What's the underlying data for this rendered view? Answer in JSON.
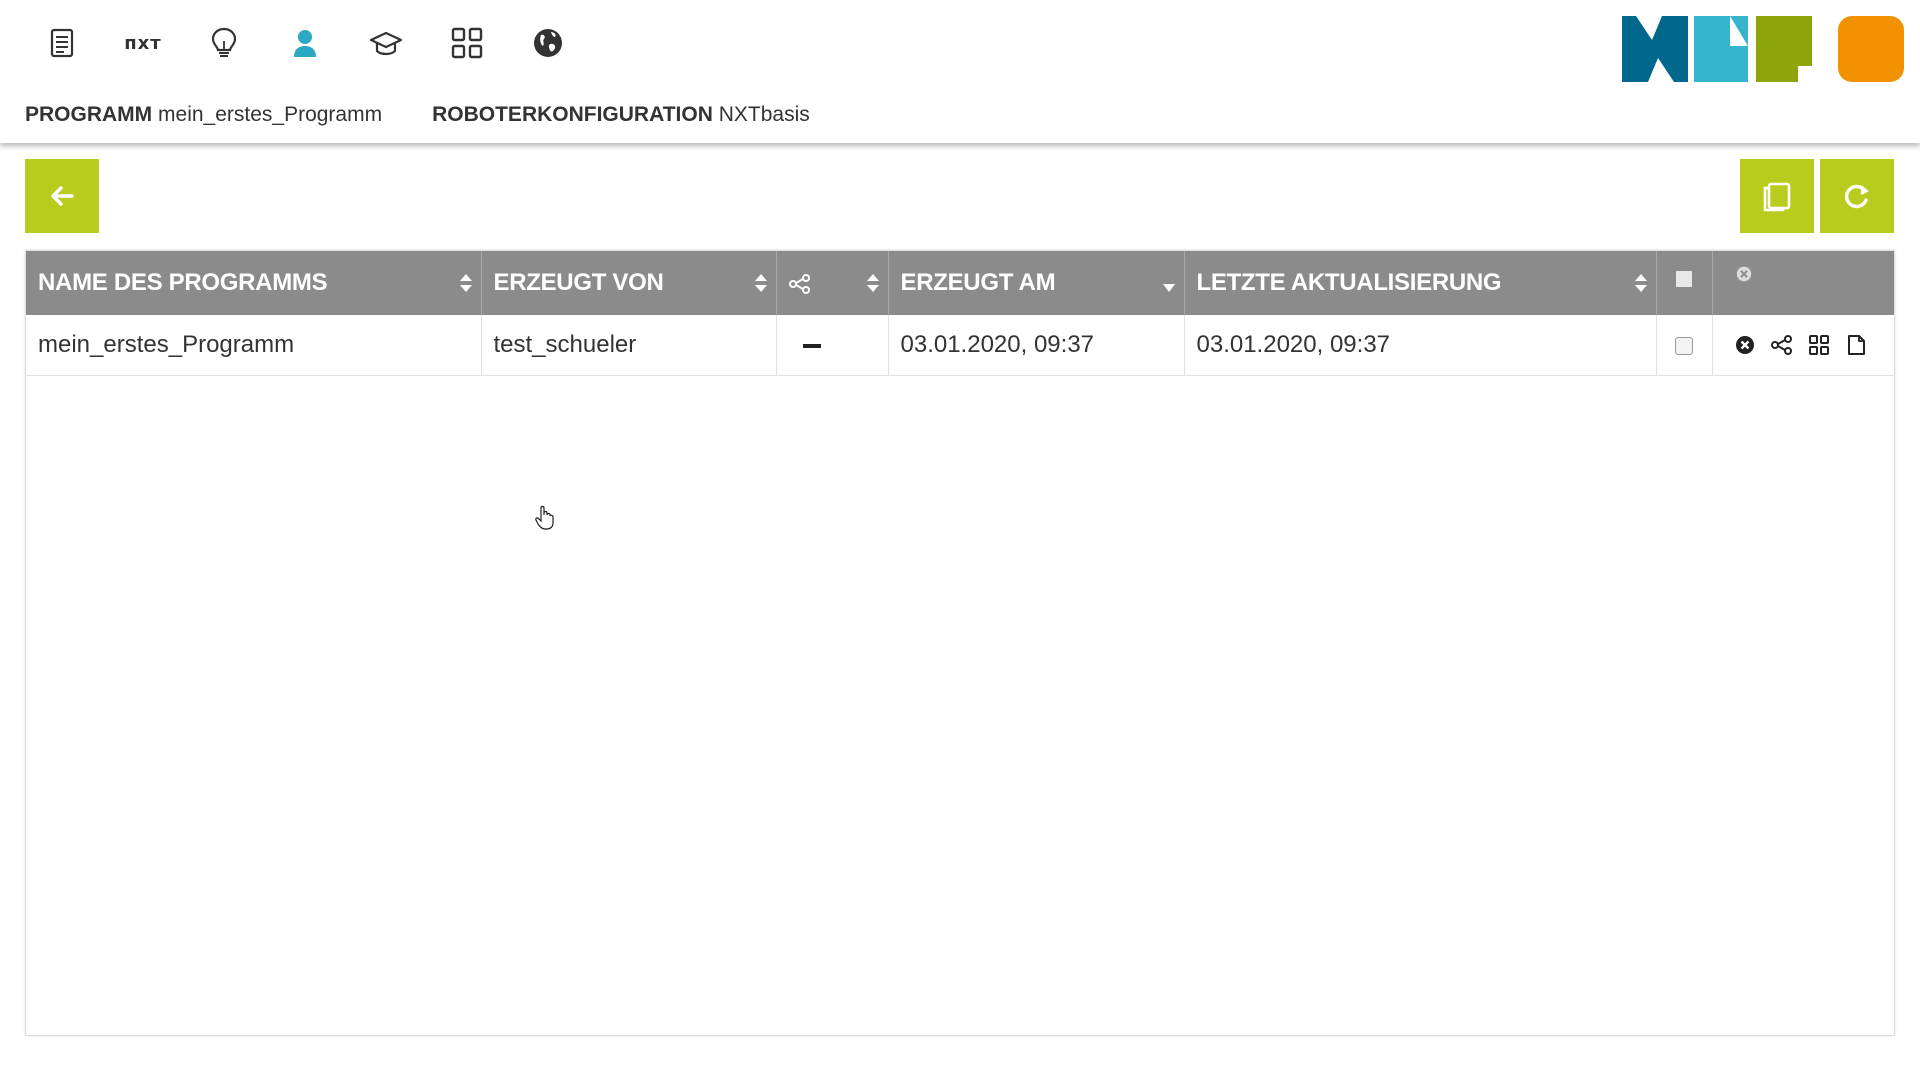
{
  "nav": {
    "nxt_label": "пхт"
  },
  "breadcrumbs": {
    "program_label": "PROGRAMM",
    "program_value": "mein_erstes_Programm",
    "config_label": "ROBOTERKONFIGURATION",
    "config_value": "NXTbasis"
  },
  "colors": {
    "accent": "#b8cc1e",
    "header_bg": "#8b8b8b",
    "active_icon": "#2aa8c4",
    "logo": [
      "#00688d",
      "#35b4cc",
      "#8fa40b",
      "#f39200"
    ]
  },
  "table": {
    "headers": {
      "name": "NAME DES PROGRAMMS",
      "created_by": "ERZEUGT VON",
      "created_at": "ERZEUGT AM",
      "updated_at": "LETZTE AKTUALISIERUNG"
    },
    "rows": [
      {
        "name": "mein_erstes_Programm",
        "created_by": "test_schueler",
        "shared": "—",
        "created_at": "03.01.2020, 09:37",
        "updated_at": "03.01.2020, 09:37"
      }
    ]
  },
  "icons": {
    "nav": [
      "list-icon",
      "nxt-robot-text",
      "lightbulb-icon",
      "user-icon",
      "graduation-cap-icon",
      "grid-icon",
      "globe-icon"
    ],
    "toolbar": [
      "arrow-left-icon",
      "copy-icon",
      "refresh-icon"
    ],
    "row_actions": [
      "delete-icon",
      "share-icon",
      "gallery-icon",
      "open-icon"
    ]
  }
}
